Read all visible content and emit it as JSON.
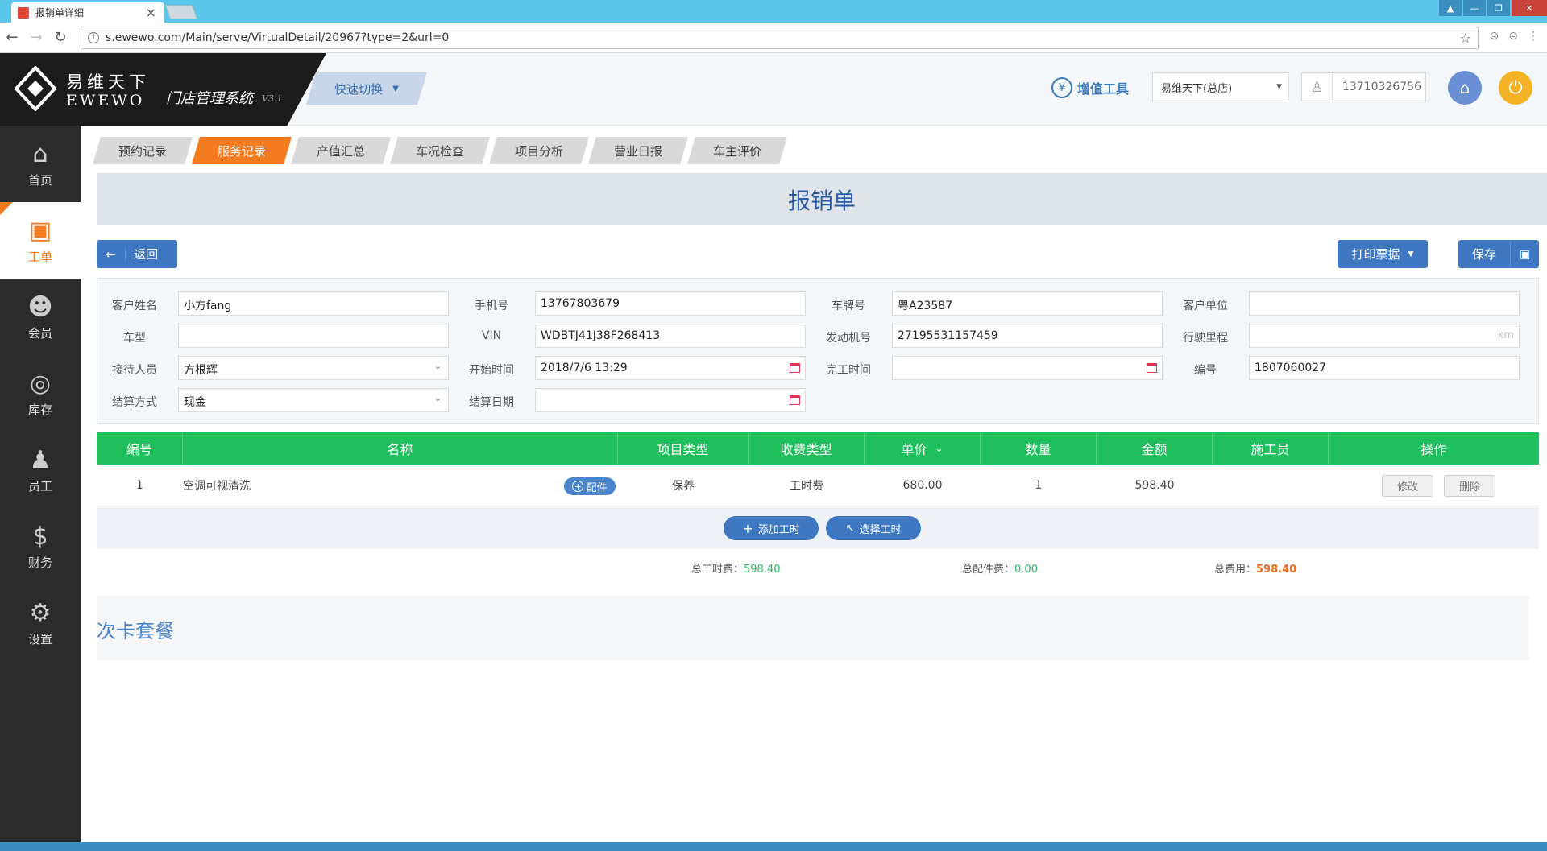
{
  "browser": {
    "tab_title": "报销单详细",
    "url": "s.ewewo.com/Main/serve/VirtualDetail/20967?type=2&url=0"
  },
  "header": {
    "logo_cn": "易维天下",
    "logo_en": "EWEWO",
    "system_name": "门店管理系统",
    "version": "V3.1",
    "quick_switch": "快速切换",
    "value_added_tools": "增值工具",
    "store": "易维天下(总店)",
    "user_phone": "13710326756"
  },
  "sidebar": {
    "items": [
      {
        "label": "首页",
        "icon": "home-icon"
      },
      {
        "label": "工单",
        "icon": "workorder-icon"
      },
      {
        "label": "会员",
        "icon": "member-icon"
      },
      {
        "label": "库存",
        "icon": "inventory-icon"
      },
      {
        "label": "员工",
        "icon": "staff-icon"
      },
      {
        "label": "财务",
        "icon": "finance-icon"
      },
      {
        "label": "设置",
        "icon": "gear-icon"
      }
    ]
  },
  "tabs": [
    "预约记录",
    "服务记录",
    "产值汇总",
    "车况检查",
    "项目分析",
    "营业日报",
    "车主评价"
  ],
  "page": {
    "title": "报销单",
    "back": "返回",
    "print": "打印票据",
    "save": "保存"
  },
  "form": {
    "customer_name": {
      "label": "客户姓名",
      "value": "小方fang"
    },
    "phone": {
      "label": "手机号",
      "value": "13767803679"
    },
    "plate": {
      "label": "车牌号",
      "value": "粤A23587"
    },
    "company": {
      "label": "客户单位",
      "value": ""
    },
    "model": {
      "label": "车型",
      "value": ""
    },
    "vin": {
      "label": "VIN",
      "value": "WDBTJ41J38F268413"
    },
    "engine": {
      "label": "发动机号",
      "value": "27195531157459"
    },
    "mileage": {
      "label": "行驶里程",
      "value": "",
      "unit": "km"
    },
    "receptionist": {
      "label": "接待人员",
      "value": "方根辉"
    },
    "start_time": {
      "label": "开始时间",
      "value": "2018/7/6 13:29"
    },
    "finish_time": {
      "label": "完工时间",
      "value": ""
    },
    "number": {
      "label": "编号",
      "value": "1807060027"
    },
    "payment": {
      "label": "结算方式",
      "value": "现金"
    },
    "settle_date": {
      "label": "结算日期",
      "value": ""
    }
  },
  "table": {
    "headers": [
      "编号",
      "名称",
      "项目类型",
      "收费类型",
      "单价",
      "数量",
      "金额",
      "施工员",
      "操作"
    ],
    "rows": [
      {
        "no": "1",
        "name": "空调可视清洗",
        "part_btn": "配件",
        "type": "保养",
        "fee_type": "工时费",
        "price": "680.00",
        "qty": "1",
        "amount": "598.40",
        "worker": "",
        "edit": "修改",
        "delete": "删除"
      }
    ],
    "add_labor": "添加工时",
    "select_labor": "选择工时"
  },
  "totals": {
    "labor_label": "总工时费：",
    "labor_value": "598.40",
    "parts_label": "总配件费：",
    "parts_value": "0.00",
    "total_label": "总费用：",
    "total_value": "598.40"
  },
  "card_section": {
    "title": "次卡套餐"
  },
  "colors": {
    "accent_orange": "#f47b20",
    "primary_blue": "#3e78c3",
    "table_green": "#1ebf5c",
    "sidebar_dark": "#2b2b2b"
  }
}
